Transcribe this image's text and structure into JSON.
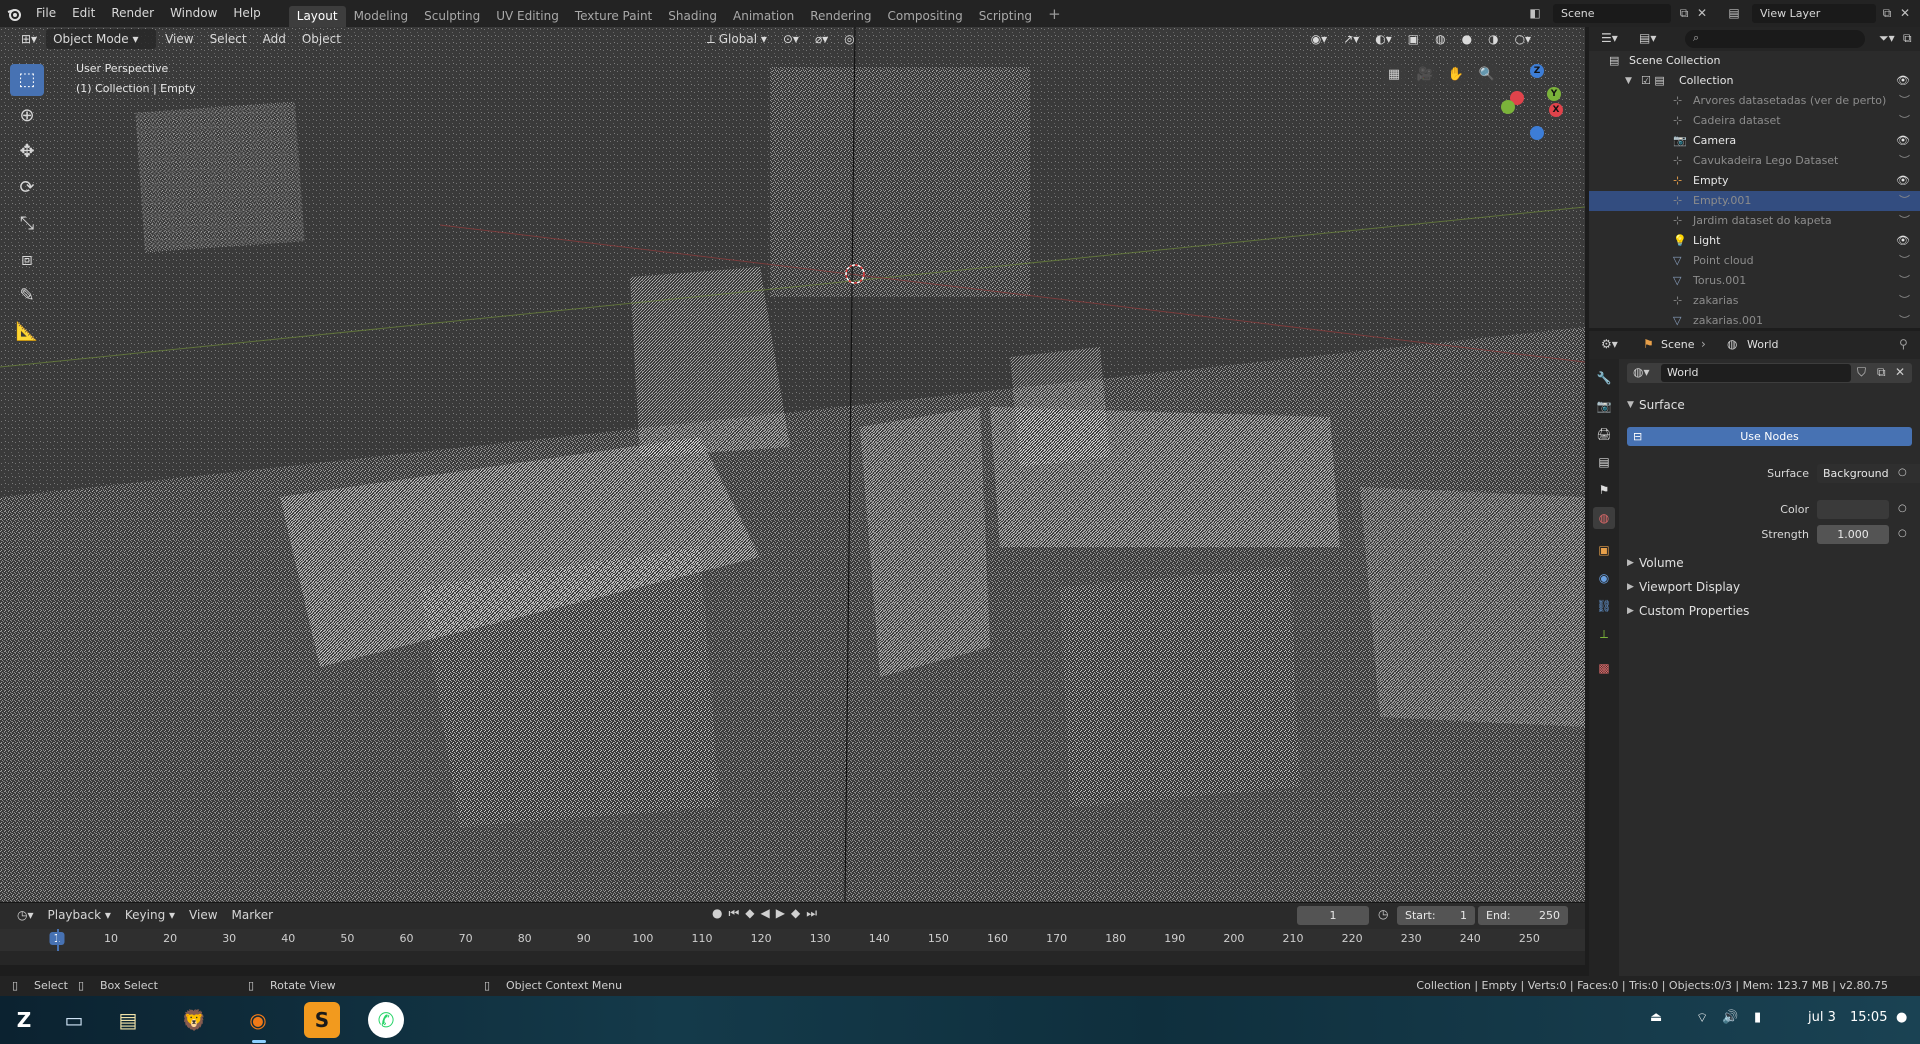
{
  "menubar": {
    "items": [
      "File",
      "Edit",
      "Render",
      "Window",
      "Help"
    ],
    "workspaces": [
      "Layout",
      "Modeling",
      "Sculpting",
      "UV Editing",
      "Texture Paint",
      "Shading",
      "Animation",
      "Rendering",
      "Compositing",
      "Scripting"
    ],
    "active_workspace": "Layout",
    "add_workspace": "+",
    "scene_name": "Scene",
    "view_layer": "View Layer"
  },
  "viewport": {
    "mode": "Object Mode",
    "menus": [
      "View",
      "Select",
      "Add",
      "Object"
    ],
    "orientation": "Global",
    "perspective_label": "User Perspective",
    "collection_label": "(1) Collection | Empty",
    "gizmo_axes": [
      "X",
      "Y",
      "Z"
    ]
  },
  "timeline": {
    "menus": [
      "Playback",
      "Keying",
      "View",
      "Marker"
    ],
    "current_frame": "1",
    "start_label": "Start:",
    "start": "1",
    "end_label": "End:",
    "end": "250",
    "ticks": [
      "1",
      "10",
      "20",
      "30",
      "40",
      "50",
      "60",
      "70",
      "80",
      "90",
      "100",
      "110",
      "120",
      "130",
      "140",
      "150",
      "160",
      "170",
      "180",
      "190",
      "200",
      "210",
      "220",
      "230",
      "240",
      "250"
    ]
  },
  "statusbar": {
    "select": "Select",
    "box_select": "Box Select",
    "rotate_view": "Rotate View",
    "context_menu": "Object Context Menu",
    "stats": "Collection | Empty | Verts:0 | Faces:0 | Tris:0 | Objects:0/3 | Mem: 123.7 MB | v2.80.75"
  },
  "outliner": {
    "scene_collection": "Scene Collection",
    "collection": "Collection",
    "items": [
      {
        "label": "Arvores datasetadas (ver de perto)",
        "dim": true,
        "icon": "empty-icon",
        "selected": false,
        "visible": false
      },
      {
        "label": "Cadeira dataset",
        "dim": true,
        "icon": "empty-icon",
        "selected": false,
        "visible": false
      },
      {
        "label": "Camera",
        "dim": false,
        "icon": "camera-icon",
        "selected": false,
        "visible": true
      },
      {
        "label": "Cavukadeira Lego Dataset",
        "dim": true,
        "icon": "empty-icon",
        "selected": false,
        "visible": false
      },
      {
        "label": "Empty",
        "dim": false,
        "icon": "empty-icon",
        "selected": false,
        "visible": true
      },
      {
        "label": "Empty.001",
        "dim": true,
        "icon": "empty-icon",
        "selected": true,
        "visible": false
      },
      {
        "label": "Jardim dataset do kapeta",
        "dim": true,
        "icon": "empty-icon",
        "selected": false,
        "visible": false
      },
      {
        "label": "Light",
        "dim": false,
        "icon": "light-icon",
        "selected": false,
        "visible": true
      },
      {
        "label": "Point cloud",
        "dim": true,
        "icon": "mesh-icon",
        "selected": false,
        "visible": false
      },
      {
        "label": "Torus.001",
        "dim": true,
        "icon": "mesh-icon",
        "selected": false,
        "visible": false
      },
      {
        "label": "zakarias",
        "dim": true,
        "icon": "empty-icon",
        "selected": false,
        "visible": false
      },
      {
        "label": "zakarias.001",
        "dim": true,
        "icon": "mesh-icon",
        "selected": false,
        "visible": false
      }
    ]
  },
  "properties": {
    "breadcrumb_scene": "Scene",
    "breadcrumb_world": "World",
    "world_name": "World",
    "surface_panel": "Surface",
    "use_nodes": "Use Nodes",
    "surface_label": "Surface",
    "surface_value": "Background",
    "color_label": "Color",
    "strength_label": "Strength",
    "strength_value": "1.000",
    "panels": [
      "Volume",
      "Viewport Display",
      "Custom Properties"
    ]
  },
  "taskbar": {
    "time": "15:05",
    "date": "jul 3"
  },
  "colors": {
    "accent": "#4772b3",
    "selected_row": "#334d80",
    "header": "#232323",
    "panel": "#2b2b2b"
  }
}
